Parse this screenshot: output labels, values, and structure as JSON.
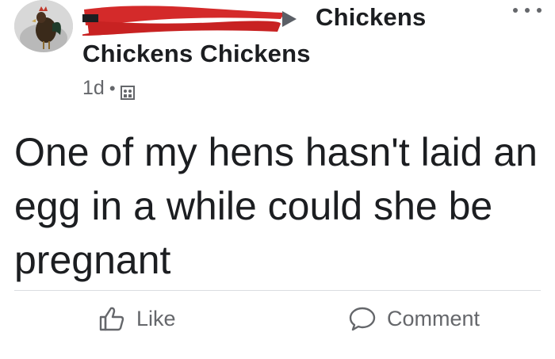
{
  "post": {
    "group_name_short": "Chickens",
    "group_name_full": "Chickens Chickens",
    "timestamp": "1d",
    "separator": "•",
    "audience_icon": "group-icon",
    "more_icon": "more-options-icon",
    "text": "One of my hens hasn't laid an egg in a while could she be pregnant"
  },
  "actions": {
    "like_label": "Like",
    "like_icon": "thumbs-up-icon",
    "comment_label": "Comment",
    "comment_icon": "speech-bubble-icon"
  },
  "colors": {
    "redaction": "#d42a2a",
    "secondary_text": "#65676b",
    "primary_text": "#1c1e21",
    "divider": "#dadde1"
  }
}
